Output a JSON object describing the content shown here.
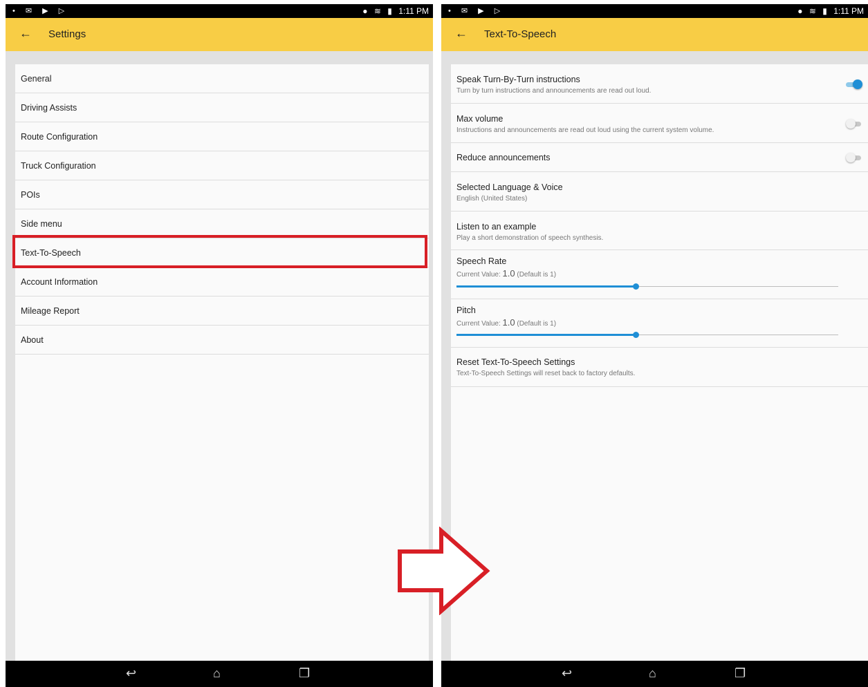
{
  "status": {
    "icons_left": "• ✉ ▶ ▷",
    "time": "1:11 PM"
  },
  "left": {
    "title": "Settings",
    "items": [
      {
        "label": "General"
      },
      {
        "label": "Driving Assists"
      },
      {
        "label": "Route Configuration"
      },
      {
        "label": "Truck Configuration"
      },
      {
        "label": "POIs"
      },
      {
        "label": "Side menu"
      },
      {
        "label": "Text-To-Speech"
      },
      {
        "label": "Account Information"
      },
      {
        "label": "Mileage Report"
      },
      {
        "label": "About"
      }
    ]
  },
  "right": {
    "title": "Text-To-Speech",
    "rows": [
      {
        "title": "Speak Turn-By-Turn instructions",
        "subtitle": "Turn by turn instructions and announcements are read out loud.",
        "toggle": "on"
      },
      {
        "title": "Max volume",
        "subtitle": "Instructions and announcements are read out loud using the current system volume.",
        "toggle": "off"
      },
      {
        "title": "Reduce announcements",
        "toggle": "off"
      },
      {
        "title": "Selected Language & Voice",
        "subtitle": "English (United States)"
      },
      {
        "title": "Listen to an example",
        "subtitle": "Play a short demonstration of speech synthesis."
      }
    ],
    "sliders": [
      {
        "title": "Speech Rate",
        "prefix": "Current Value: ",
        "value_text": "1.0",
        "suffix": " (Default is 1)",
        "position": 0.47
      },
      {
        "title": "Pitch",
        "prefix": "Current Value: ",
        "value_text": "1.0",
        "suffix": " (Default is 1)",
        "position": 0.47
      }
    ],
    "reset": {
      "title": "Reset Text-To-Speech Settings",
      "subtitle": "Text-To-Speech Settings will reset back to factory defaults."
    }
  },
  "colors": {
    "appbar": "#f8cd45",
    "accent": "#1f8fd6",
    "highlight": "#d81f26"
  },
  "icons": {
    "back": "arrow-left-icon",
    "nav": [
      "back-nav-icon",
      "home-icon",
      "recents-icon"
    ]
  }
}
